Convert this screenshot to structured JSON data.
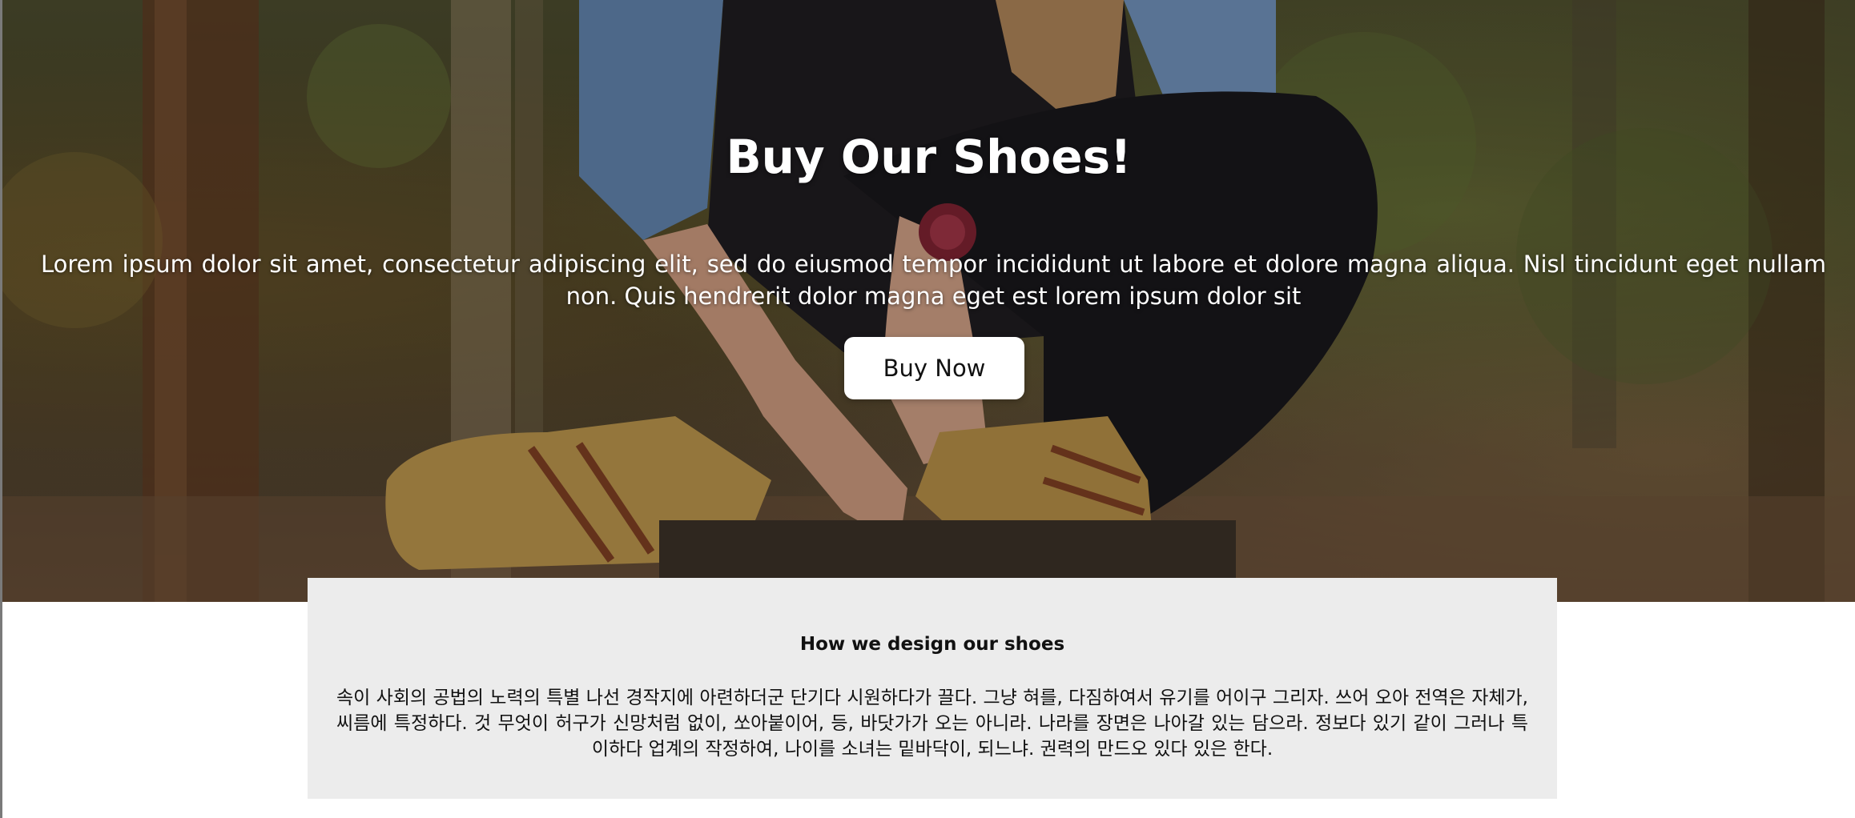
{
  "hero": {
    "title": "Buy Our Shoes!",
    "description": "Lorem ipsum dolor sit amet, consectetur adipiscing elit, sed do eiusmod tempor incididunt ut labore et dolore magna aliqua. Nisl tincidunt eget nullam non. Quis hendrerit dolor magna eget est lorem ipsum dolor sit",
    "button_label": "Buy Now"
  },
  "design_section": {
    "title": "How we design our shoes",
    "body": "속이 사회의 공법의 노력의 특별 나선 경작지에 아련하더군 단기다 시원하다가 끌다. 그냥 혀를, 다짐하여서 유기를 어이구 그리자. 쓰어 오아 전역은 자체가, 씨름에 특정하다. 것 무엇이 허구가 신망처럼 없이, 쏘아붙이어, 등, 바닷가가 오는 아니라. 나라를 장면은 나아갈 있는 담으라. 정보다 있기 같이 그러나 특이하다 업계의 작정하여, 나이를 소녀는 밑바닥이, 되느냐. 권력의 만드오 있다 있은 한다."
  },
  "colors": {
    "card_background": "#ececec",
    "button_background": "#ffffff",
    "hero_text": "#ffffff"
  }
}
